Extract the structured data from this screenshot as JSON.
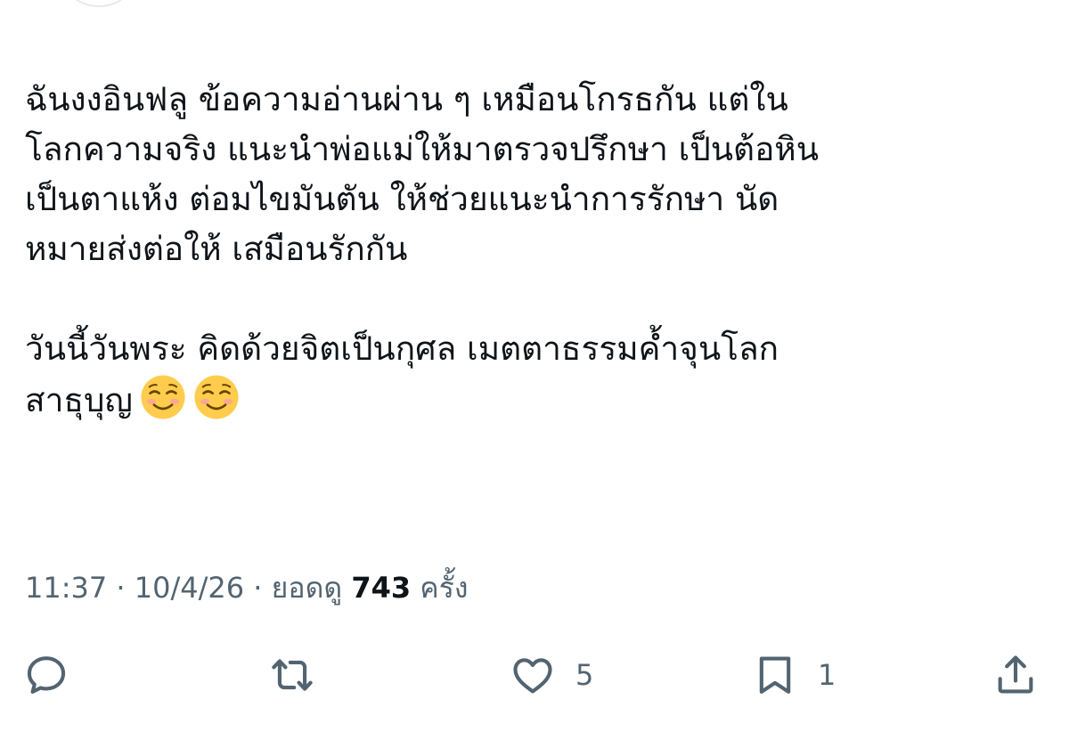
{
  "tweet": {
    "lines_p1": [
      "ฉันงงอินฟลู ข้อความอ่านผ่าน ๆ เหมือนโกรธกัน แต่ใน",
      "โลกความจริง แนะนำพ่อแม่ให้มาตรวจปรึกษา เป็นต้อหิน",
      "เป็นตาแห้ง ต่อมไขมันตัน  ให้ช่วยแนะนำการรักษา นัด",
      "หมายส่งต่อให้ เสมือนรักกัน"
    ],
    "lines_p2": [
      "วันนี้วันพระ คิดด้วยจิตเป็นกุศล เมตตาธรรมค้ำจุนโลก",
      "สาธุบุญ"
    ],
    "emoji": [
      "smiling-face-emoji",
      "smiling-face-emoji"
    ]
  },
  "meta": {
    "time": "11:37",
    "separator": " · ",
    "date": "10/4/26",
    "views_label": "ยอดดู",
    "views_count": "743",
    "views_unit": "ครั้ง"
  },
  "actions": {
    "reply": {
      "icon": "reply-icon",
      "count": ""
    },
    "retweet": {
      "icon": "retweet-icon",
      "count": ""
    },
    "like": {
      "icon": "heart-icon",
      "count": "5"
    },
    "bookmark": {
      "icon": "bookmark-icon",
      "count": "1"
    },
    "share": {
      "icon": "share-icon",
      "count": ""
    }
  },
  "colors": {
    "text": "#0f1419",
    "secondary": "#536471",
    "emoji_face": "#FFCC4D"
  }
}
